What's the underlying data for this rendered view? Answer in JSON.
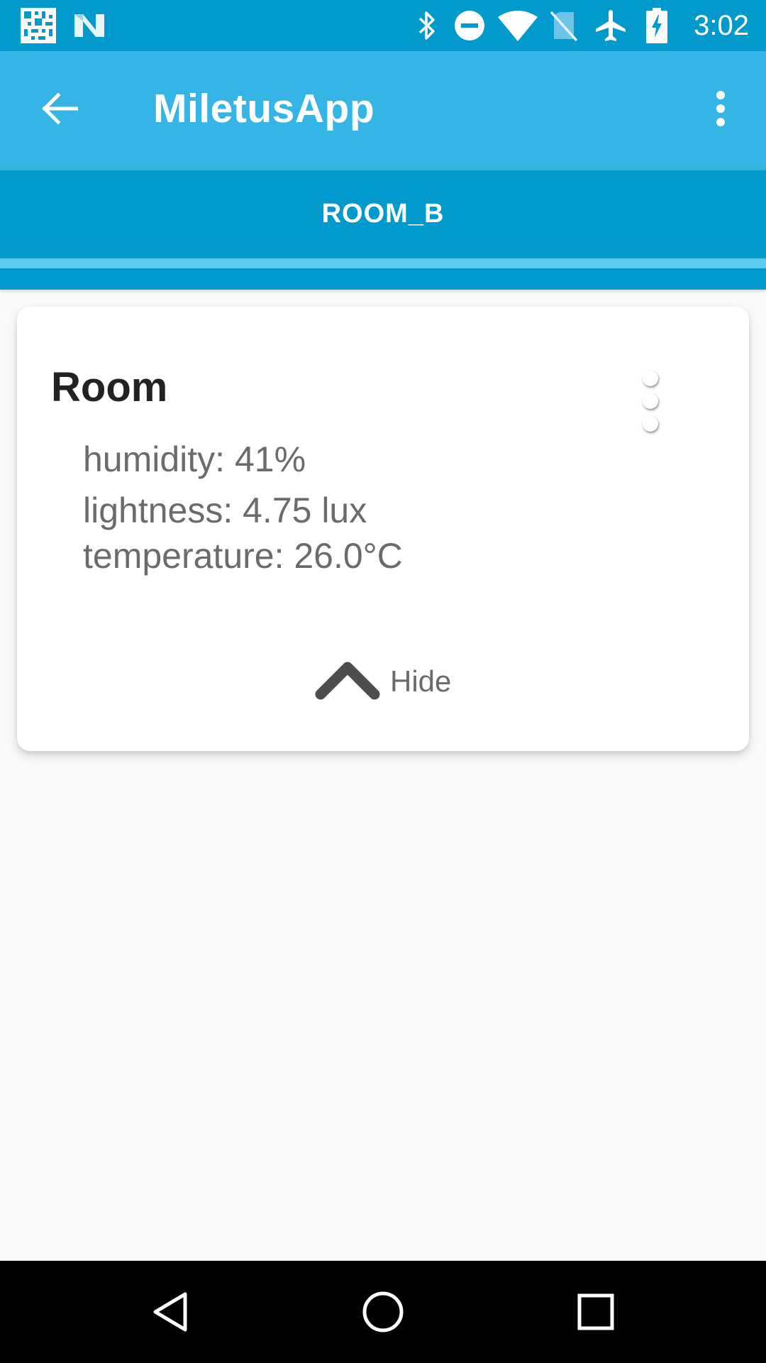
{
  "status_bar": {
    "time": "3:02",
    "background": "#0299cc",
    "icons": [
      "qr-code-icon",
      "notification-n-icon",
      "bluetooth-icon",
      "do-not-disturb-icon",
      "wifi-icon",
      "no-sim-icon",
      "airplane-mode-icon",
      "battery-charging-icon"
    ]
  },
  "app_bar": {
    "title": "MiletusApp",
    "background": "#35b5e6",
    "back_icon": "arrow-back-icon",
    "overflow_icon": "more-vert-icon"
  },
  "tabs": [
    {
      "label": "ROOM_B",
      "selected": true
    }
  ],
  "card": {
    "title": "Room",
    "readings": [
      {
        "text": "humidity: 41%"
      },
      {
        "text": "lightness: 4.75 lux"
      },
      {
        "text": "temperature: 26.0°C"
      }
    ],
    "hide_label": "Hide",
    "hide_icon": "chevron-up-icon"
  },
  "nav_bar": {
    "icons": [
      "back-triangle-icon",
      "home-circle-icon",
      "recents-square-icon"
    ]
  }
}
